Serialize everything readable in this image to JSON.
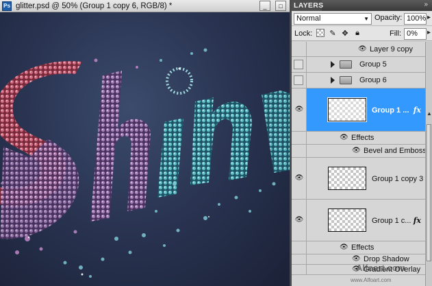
{
  "document": {
    "app_icon_label": "Ps",
    "title": "glitter.psd @ 50% (Group 1 copy 6, RGB/8) *",
    "minimize_label": "_",
    "maximize_label": "□",
    "canvas_text": "Shini",
    "canvas_colors": {
      "background": "#28324c",
      "red": "#c0455f",
      "purple": "#9a6fa8",
      "teal": "#5ec2c9"
    }
  },
  "panel": {
    "tab_label": "LAYERS",
    "menu_label": "»",
    "blend_mode": "Normal",
    "opacity_label": "Opacity:",
    "opacity_value": "100%",
    "lock_label": "Lock:",
    "fill_label": "Fill:",
    "fill_value": "0%",
    "selection_color": "#3399ff"
  },
  "layers": [
    {
      "name": "Layer 9 copy",
      "type": "effect-child"
    },
    {
      "name": "Group 5",
      "type": "group",
      "visible": false
    },
    {
      "name": "Group 6",
      "type": "group",
      "visible": false
    },
    {
      "name": "Group 1 ...",
      "type": "layer",
      "selected": true,
      "fx": "fx"
    },
    {
      "name": "Effects",
      "type": "effects-header"
    },
    {
      "name": "Bevel and Emboss",
      "type": "effect"
    },
    {
      "name": "Group 1 copy 3",
      "type": "layer"
    },
    {
      "name": "Group 1 c...",
      "type": "layer",
      "fx": "fx"
    },
    {
      "name": "Effects",
      "type": "effects-header"
    },
    {
      "name": "Drop Shadow",
      "type": "effect"
    },
    {
      "name": "Gradient Overlay",
      "type": "effect"
    }
  ],
  "watermark": {
    "text": "Alfoart.com",
    "url": "www.Alfoart.com"
  }
}
